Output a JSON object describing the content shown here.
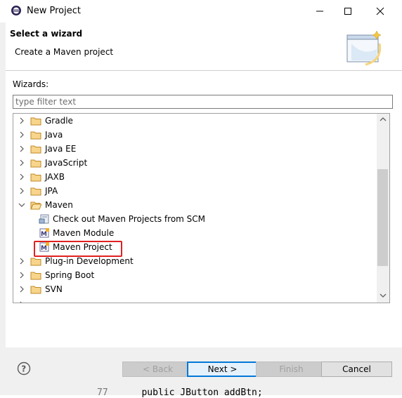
{
  "window": {
    "title": "New Project"
  },
  "header": {
    "title": "Select a wizard",
    "description": "Create a Maven project"
  },
  "wizards": {
    "label": "Wizards:",
    "filter_placeholder": "type filter text",
    "tree": [
      {
        "label": "Gradle",
        "type": "folder",
        "expanded": false
      },
      {
        "label": "Java",
        "type": "folder",
        "expanded": false
      },
      {
        "label": "Java EE",
        "type": "folder",
        "expanded": false
      },
      {
        "label": "JavaScript",
        "type": "folder",
        "expanded": false
      },
      {
        "label": "JAXB",
        "type": "folder",
        "expanded": false
      },
      {
        "label": "JPA",
        "type": "folder",
        "expanded": false
      },
      {
        "label": "Maven",
        "type": "folder",
        "expanded": true
      },
      {
        "label": "Check out Maven Projects from SCM",
        "type": "leaf",
        "icon": "scm-checkout-icon"
      },
      {
        "label": "Maven Module",
        "type": "leaf",
        "icon": "maven-module-icon"
      },
      {
        "label": "Maven Project",
        "type": "leaf",
        "icon": "maven-project-icon",
        "selected": true
      },
      {
        "label": "Plug-in Development",
        "type": "folder",
        "expanded": false
      },
      {
        "label": "Spring Boot",
        "type": "folder",
        "expanded": false
      },
      {
        "label": "SVN",
        "type": "folder",
        "expanded": false
      }
    ]
  },
  "buttons": {
    "back": "< Back",
    "next": "Next >",
    "finish": "Finish",
    "cancel": "Cancel"
  },
  "background": {
    "code_line_number": "77",
    "code_text": "public JButton addBtn;"
  },
  "colors": {
    "selection_border": "#e02020",
    "default_button_border": "#0078d7",
    "folder": "#e8b34a"
  }
}
